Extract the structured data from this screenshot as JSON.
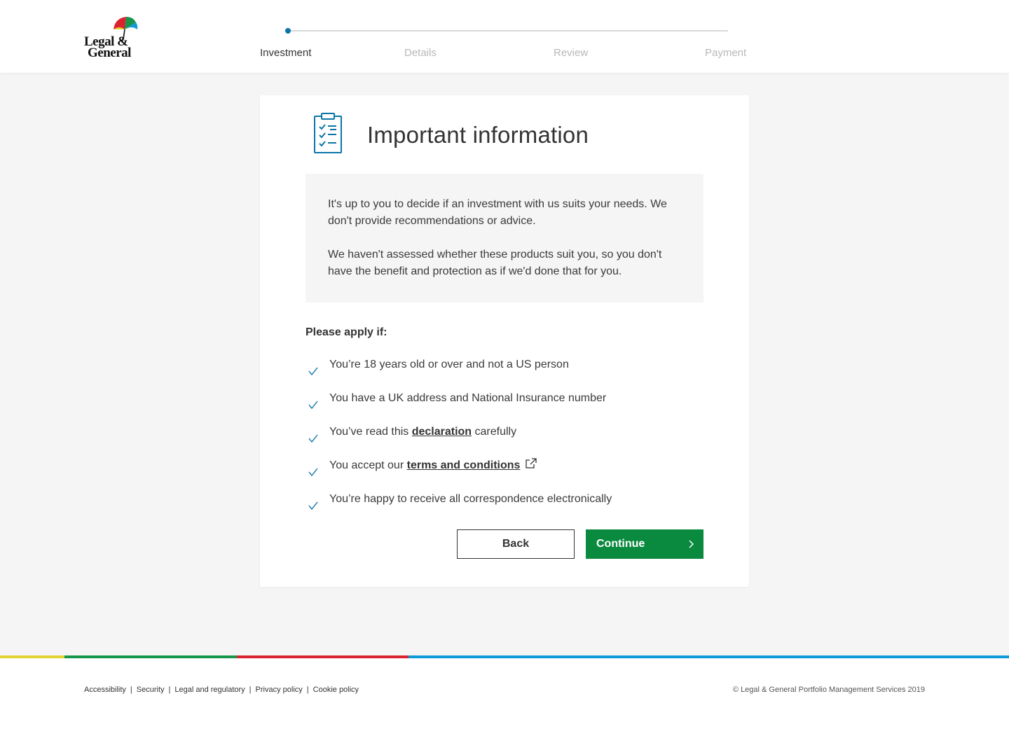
{
  "brand": {
    "logo_line1": "Legal &",
    "logo_line2": "General",
    "colors": {
      "primary_green": "#0a8a3e",
      "progress_blue": "#0b75a8",
      "check_blue": "#0b75a8"
    }
  },
  "progress": {
    "current_step": 1,
    "steps": [
      {
        "label": "Investment",
        "active": true
      },
      {
        "label": "Details",
        "active": false
      },
      {
        "label": "Review",
        "active": false
      },
      {
        "label": "Payment",
        "active": false
      }
    ]
  },
  "card": {
    "icon": "clipboard-checklist-icon",
    "title": "Important information",
    "info_paragraphs": [
      "It's up to you to decide if an investment with us suits your needs. We don't provide recommendations or advice.",
      "We haven't assessed whether these products suit you, so you don't have the benefit and protection as if we'd done that for you."
    ],
    "apply_label": "Please apply if:",
    "conditions": [
      {
        "text": "You’re 18 years old or over and not a US person"
      },
      {
        "text": "You have a UK address and National Insurance number"
      },
      {
        "prefix": "You’ve read this ",
        "link": "declaration",
        "suffix": " carefully"
      },
      {
        "prefix": "You accept our ",
        "link": "terms and conditions",
        "icon": "external-link-icon"
      },
      {
        "text": "You’re happy to receive all correspondence electronically"
      }
    ],
    "back_label": "Back",
    "continue_label": "Continue"
  },
  "colour_bar": [
    "#e2d234",
    "#17954b",
    "#d9232e",
    "#0e9ad8"
  ],
  "footer": {
    "links": [
      "Accessibility",
      "Security",
      "Legal and regulatory",
      "Privacy policy",
      "Cookie policy"
    ],
    "copyright": "© Legal & General Portfolio Management Services 2019"
  }
}
